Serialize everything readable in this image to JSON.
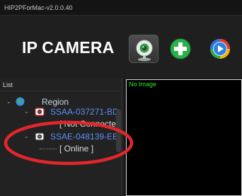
{
  "window": {
    "title": "HIP2PForMac-v2.0.0.40"
  },
  "header": {
    "app_title": "IP CAMERA",
    "tools": [
      {
        "name": "camera-view",
        "icon": "webcam-icon",
        "active": true
      },
      {
        "name": "add-device",
        "icon": "plus-circle-icon",
        "active": false
      },
      {
        "name": "playback",
        "icon": "play-circle-icon",
        "active": false
      }
    ]
  },
  "sidebar": {
    "header": "List",
    "tree": {
      "root_label": "Region",
      "devices": [
        {
          "id_label": "SSAA-037271-BD",
          "status": "[ Not Connecte"
        },
        {
          "id_label": "SSAE-048139-EE",
          "status": "[ Online ]"
        }
      ]
    }
  },
  "video": {
    "label": "No Image"
  },
  "annotation": {
    "color": "#e3262b"
  },
  "colors": {
    "device_text": "#5c8ef3",
    "video_label": "#29e62f"
  }
}
